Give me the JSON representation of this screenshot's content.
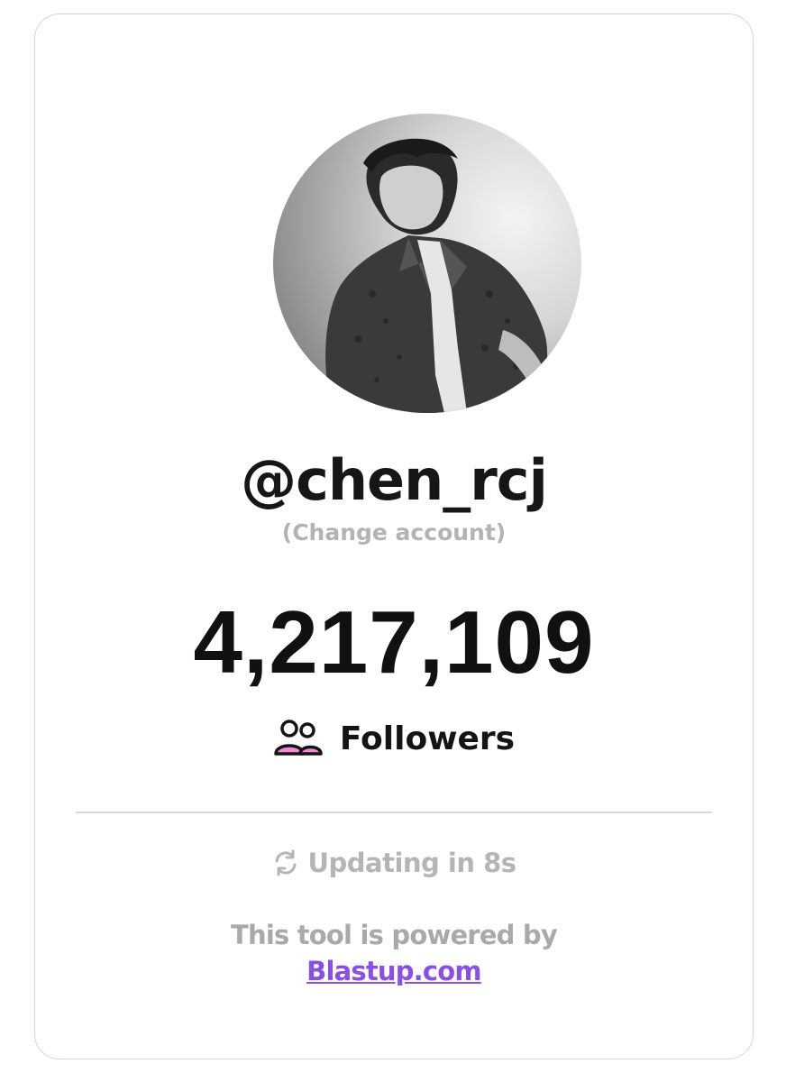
{
  "profile": {
    "username": "@chen_rcj",
    "change_account": "(Change account)",
    "avatar_icon": "profile-photo"
  },
  "stats": {
    "follower_count": "4,217,109",
    "followers_label": "Followers",
    "followers_icon": "users-icon"
  },
  "status": {
    "refresh_icon": "refresh-icon",
    "updating_text": "Updating in 8s"
  },
  "footer": {
    "powered_by": "This tool is powered by",
    "link_text": "Blastup.com"
  },
  "colors": {
    "accent_link": "#8a4fe6",
    "icon_pink": "#f08ad0",
    "muted_text": "#b3b3b3"
  }
}
